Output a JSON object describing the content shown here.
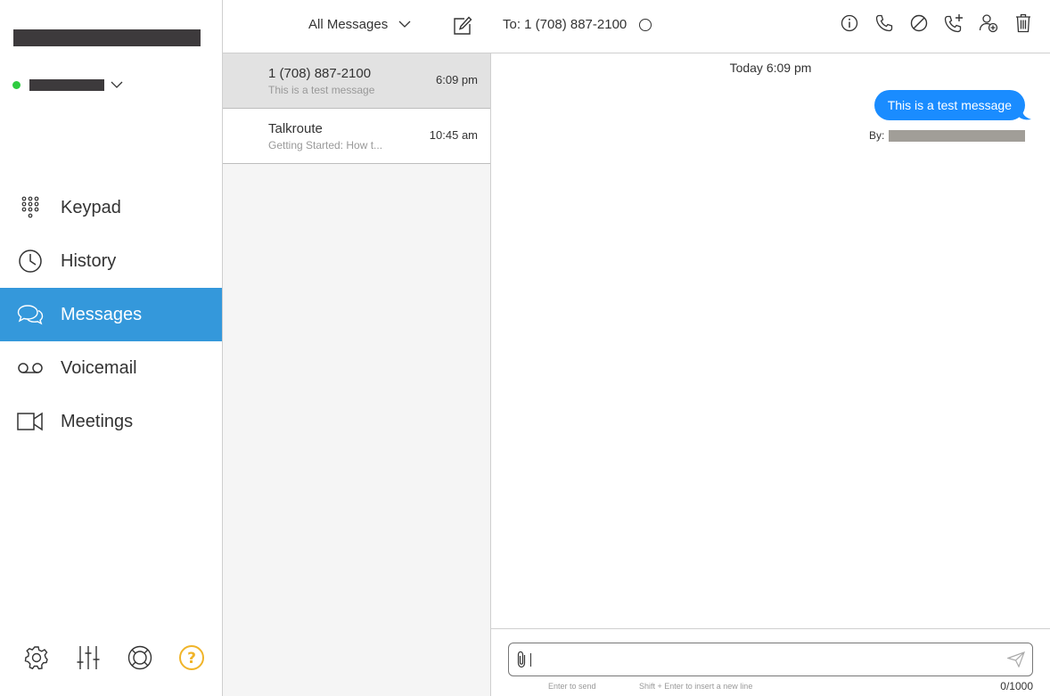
{
  "sidebar": {
    "nav": [
      {
        "label": "Keypad",
        "icon": "keypad-icon"
      },
      {
        "label": "History",
        "icon": "clock-icon"
      },
      {
        "label": "Messages",
        "icon": "chat-bubbles-icon"
      },
      {
        "label": "Voicemail",
        "icon": "voicemail-icon"
      },
      {
        "label": "Meetings",
        "icon": "video-camera-icon"
      }
    ],
    "active_index": 2,
    "bottom_icons": [
      "gear-icon",
      "sliders-icon",
      "lifebuoy-icon",
      "help-icon"
    ],
    "status_color": "#2ecc40",
    "active_color": "#3498db"
  },
  "topbar": {
    "filter_label": "All Messages",
    "to_label": "To: 1 (708) 887-2100",
    "actions": [
      "info-icon",
      "phone-icon",
      "block-icon",
      "add-call-icon",
      "add-contact-icon",
      "trash-icon"
    ]
  },
  "conversations": [
    {
      "name": "1 (708) 887-2100",
      "preview": "This is a test message",
      "time": "6:09 pm",
      "selected": true
    },
    {
      "name": "Talkroute",
      "preview": "Getting Started: How t...",
      "time": "10:45 am",
      "selected": false
    }
  ],
  "chat": {
    "day_stamp": "Today 6:09 pm",
    "messages": [
      {
        "text": "This is a test message",
        "by_label": "By:"
      }
    ],
    "bubble_color": "#1a8cff"
  },
  "composer": {
    "value": "",
    "hint_send": "Enter to send",
    "hint_newline": "Shift + Enter to insert a new line",
    "counter": "0/1000"
  }
}
